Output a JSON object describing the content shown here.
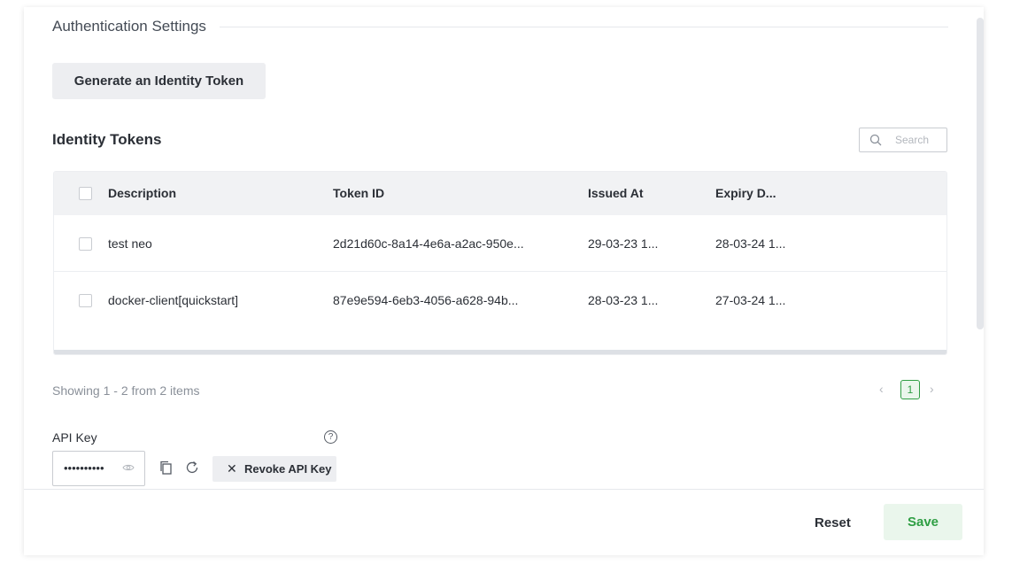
{
  "auth": {
    "section_title": "Authentication Settings",
    "generate_button": "Generate an Identity Token"
  },
  "tokens": {
    "title": "Identity Tokens",
    "search_placeholder": "Search",
    "columns": {
      "description": "Description",
      "token_id": "Token ID",
      "issued_at": "Issued At",
      "expiry": "Expiry D..."
    },
    "rows": [
      {
        "description": "test neo",
        "token_id": "2d21d60c-8a14-4e6a-a2ac-950e...",
        "issued_at": "29-03-23 1...",
        "expiry": "28-03-24 1..."
      },
      {
        "description": "docker-client[quickstart]",
        "token_id": "87e9e594-6eb3-4056-a628-94b...",
        "issued_at": "28-03-23 1...",
        "expiry": "27-03-24 1..."
      }
    ],
    "paging_text": "Showing 1 - 2 from 2 items",
    "current_page": "1",
    "prev_glyph": "‹",
    "next_glyph": "›"
  },
  "api_key": {
    "label": "API Key",
    "help_glyph": "?",
    "masked_value": "••••••••••",
    "revoke_button": "Revoke API Key"
  },
  "footer": {
    "reset_label": "Reset",
    "save_label": "Save"
  },
  "colors": {
    "accent_green": "#2f9e44",
    "save_bg": "#eaf6ec",
    "header_bg": "#f1f2f4"
  }
}
